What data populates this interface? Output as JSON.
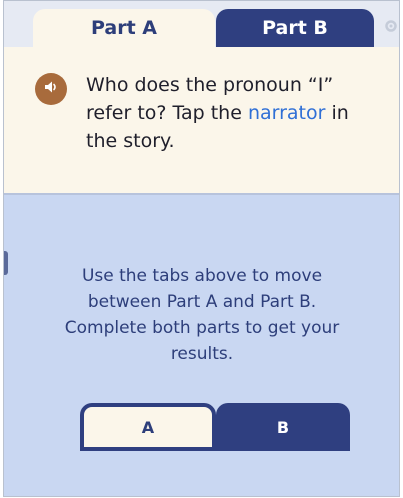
{
  "tabs": {
    "part_a": "Part A",
    "part_b": "Part B",
    "selected": "Part A"
  },
  "question": {
    "text_before": "Who does the pronoun “I” refer to? Tap the ",
    "link": "narrator",
    "text_after": " in the story."
  },
  "instructions": {
    "line1": "Use the tabs above to move",
    "line2": "between Part A and Part B.",
    "line3": "Complete both parts to get your",
    "line4": "results."
  },
  "mini_tabs": {
    "a": "A",
    "b": "B"
  },
  "colors": {
    "navy": "#2f3f80",
    "cream": "#fbf6ea",
    "panel_blue": "#c9d7f2",
    "link_blue": "#2f6fd6",
    "audio_brown": "#a86b3c"
  },
  "icons": {
    "audio": "speaker-icon",
    "settings": "gear-icon"
  }
}
